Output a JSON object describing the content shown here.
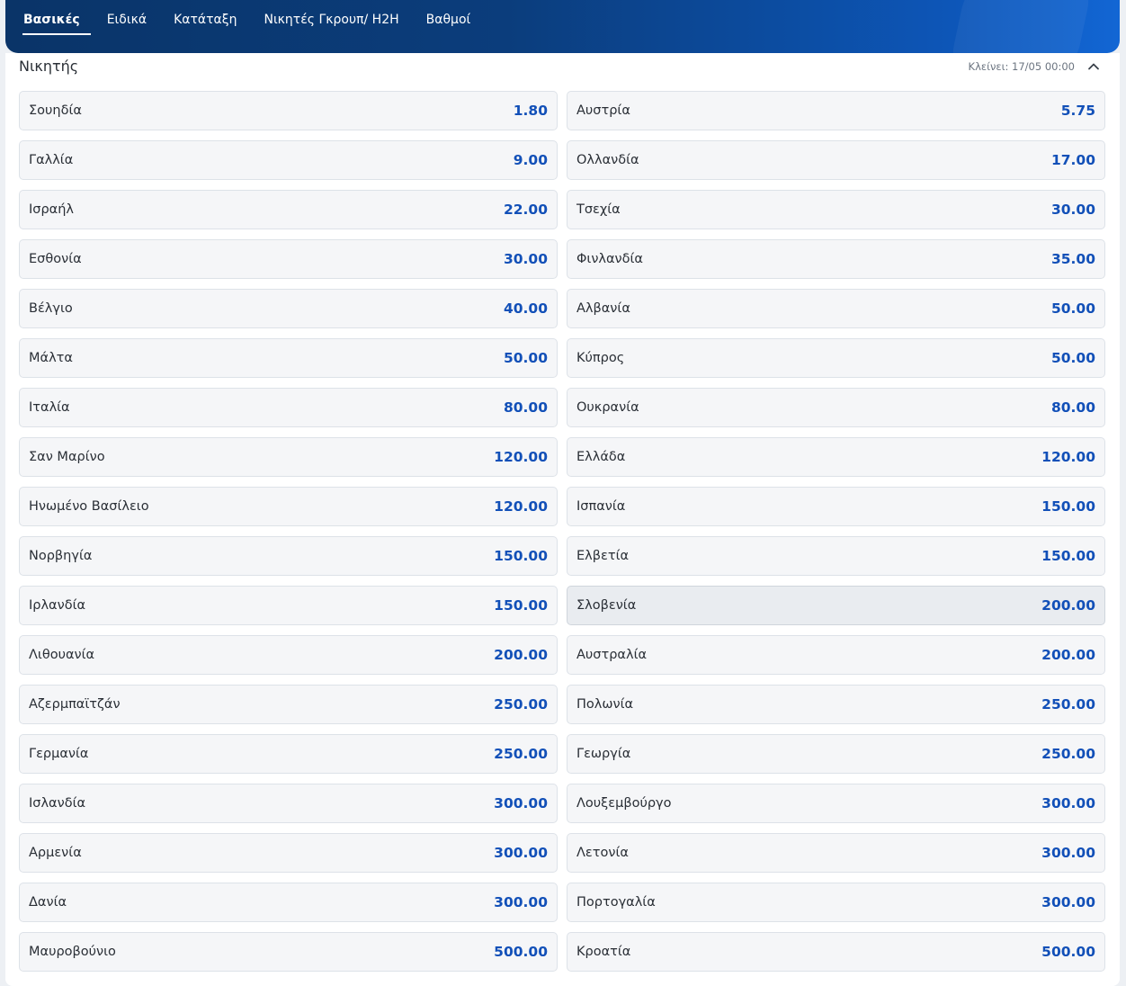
{
  "tabs": [
    {
      "label": "Βασικές",
      "active": true
    },
    {
      "label": "Ειδικά",
      "active": false
    },
    {
      "label": "Κατάταξη",
      "active": false
    },
    {
      "label": "Νικητές Γκρουπ/ H2H",
      "active": false
    },
    {
      "label": "Βαθμοί",
      "active": false
    }
  ],
  "market": {
    "title": "Νικητής",
    "closes": "Κλείνει: 17/05 00:00",
    "collapse_icon": "chevron-up-icon"
  },
  "colors": {
    "header_dark": "#0a3468",
    "header_light": "#1266d4",
    "odds_text": "#1250b8"
  },
  "selections": [
    {
      "name": "Σουηδία",
      "odds": "1.80"
    },
    {
      "name": "Αυστρία",
      "odds": "5.75"
    },
    {
      "name": "Γαλλία",
      "odds": "9.00"
    },
    {
      "name": "Ολλανδία",
      "odds": "17.00"
    },
    {
      "name": "Ισραήλ",
      "odds": "22.00"
    },
    {
      "name": "Τσεχία",
      "odds": "30.00"
    },
    {
      "name": "Εσθονία",
      "odds": "30.00"
    },
    {
      "name": "Φινλανδία",
      "odds": "35.00"
    },
    {
      "name": "Βέλγιο",
      "odds": "40.00"
    },
    {
      "name": "Αλβανία",
      "odds": "50.00"
    },
    {
      "name": "Μάλτα",
      "odds": "50.00"
    },
    {
      "name": "Κύπρος",
      "odds": "50.00"
    },
    {
      "name": "Ιταλία",
      "odds": "80.00"
    },
    {
      "name": "Ουκρανία",
      "odds": "80.00"
    },
    {
      "name": "Σαν Μαρίνο",
      "odds": "120.00"
    },
    {
      "name": "Ελλάδα",
      "odds": "120.00"
    },
    {
      "name": "Ηνωμένο Βασίλειο",
      "odds": "120.00"
    },
    {
      "name": "Ισπανία",
      "odds": "150.00"
    },
    {
      "name": "Νορβηγία",
      "odds": "150.00"
    },
    {
      "name": "Ελβετία",
      "odds": "150.00"
    },
    {
      "name": "Ιρλανδία",
      "odds": "150.00"
    },
    {
      "name": "Σλοβενία",
      "odds": "200.00",
      "hovered": true
    },
    {
      "name": "Λιθουανία",
      "odds": "200.00"
    },
    {
      "name": "Αυστραλία",
      "odds": "200.00"
    },
    {
      "name": "Αζερμπαϊτζάν",
      "odds": "250.00"
    },
    {
      "name": "Πολωνία",
      "odds": "250.00"
    },
    {
      "name": "Γερμανία",
      "odds": "250.00"
    },
    {
      "name": "Γεωργία",
      "odds": "250.00"
    },
    {
      "name": "Ισλανδία",
      "odds": "300.00"
    },
    {
      "name": "Λουξεμβούργο",
      "odds": "300.00"
    },
    {
      "name": "Αρμενία",
      "odds": "300.00"
    },
    {
      "name": "Λετονία",
      "odds": "300.00"
    },
    {
      "name": "Δανία",
      "odds": "300.00"
    },
    {
      "name": "Πορτογαλία",
      "odds": "300.00"
    },
    {
      "name": "Μαυροβούνιο",
      "odds": "500.00"
    },
    {
      "name": "Κροατία",
      "odds": "500.00"
    }
  ]
}
